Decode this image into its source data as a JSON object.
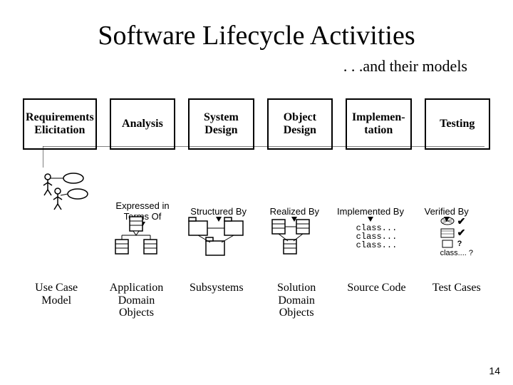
{
  "title": "Software Lifecycle Activities",
  "subtitle": ". . .and their models",
  "activities": [
    "Requirements Elicitation",
    "Analysis",
    "System Design",
    "Object Design",
    "Implemen- tation",
    "Testing"
  ],
  "connectors": [
    "",
    "Expressed in Terms Of",
    "Structured By",
    "Realized By",
    "Implemented By",
    "Verified By"
  ],
  "model_labels": [
    "Use Case Model",
    "Application Domain Objects",
    "Subsystems",
    "Solution Domain Objects",
    "Source Code",
    "Test Cases"
  ],
  "source_code_lines": [
    "class...",
    "class...",
    "class..."
  ],
  "testcase_label": "class.... ?",
  "page_number": "14"
}
